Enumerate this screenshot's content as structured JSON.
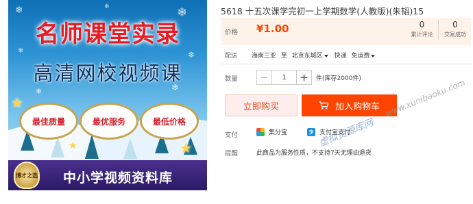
{
  "product_image": {
    "headline": "名师课堂实录",
    "subline": "高清网校视频课",
    "badges": [
      "最佳质量",
      "最优服务",
      "最低价格"
    ],
    "banner_logo": "博才之选",
    "banner_text": "中小学视频资料库"
  },
  "product": {
    "title": "5618 十五次课学完初一上学期数学(人教版)(朱韬)15"
  },
  "price": {
    "label": "价格",
    "value": "¥1.00",
    "reviews_count": "0",
    "reviews_label": "累计评论",
    "sales_count": "0",
    "sales_label": "交易成功"
  },
  "delivery": {
    "label": "配送",
    "from": "海南三亚",
    "to_word": "至",
    "destination": "北京东城区",
    "shipping": "快递",
    "fee": "免运费"
  },
  "quantity": {
    "label": "数量",
    "value": "1",
    "minus": "−",
    "plus": "+",
    "stock": "件(库存2000件)"
  },
  "actions": {
    "buy_now": "立即购买",
    "add_to_cart": "加入购物车"
  },
  "payment": {
    "label": "支付",
    "methods": [
      "集分宝",
      "支付宝支付"
    ]
  },
  "tip": {
    "label": "提醒",
    "text": "此商品为服务性质，不支持7天无理由退货"
  },
  "watermark": {
    "text": "虚拟资源库网",
    "url": "www.xunibaoku.com"
  },
  "colors": {
    "price": "#ff4400",
    "add_to_cart_bg": "#ff4400",
    "buy_now_bg": "#ffeded",
    "price_panel_bg": "#fff2e8",
    "headline": "#e61c24",
    "banner": "#2c1b66"
  },
  "icons": {
    "cart": "cart-icon",
    "jifenbao": "jifenbao-icon",
    "alipay": "alipay-icon",
    "caret": "chevron-down-icon"
  }
}
